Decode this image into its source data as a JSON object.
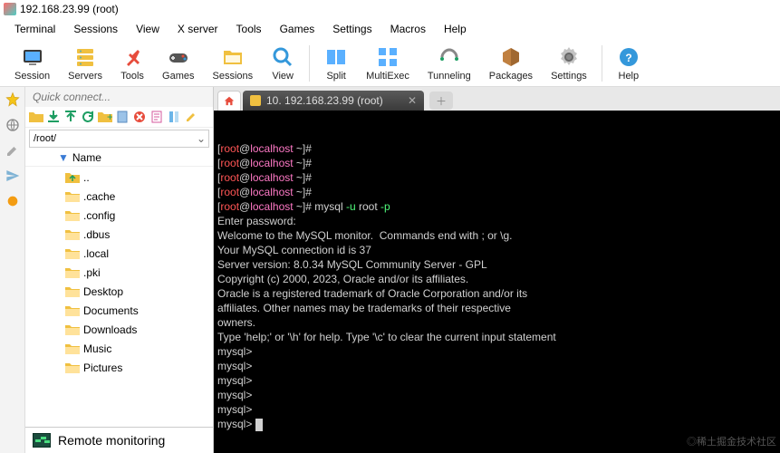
{
  "window": {
    "title": "192.168.23.99 (root)"
  },
  "menubar": [
    "Terminal",
    "Sessions",
    "View",
    "X server",
    "Tools",
    "Games",
    "Settings",
    "Macros",
    "Help"
  ],
  "toolbar": [
    {
      "label": "Session",
      "icon": "session"
    },
    {
      "label": "Servers",
      "icon": "servers"
    },
    {
      "label": "Tools",
      "icon": "tools"
    },
    {
      "label": "Games",
      "icon": "games"
    },
    {
      "label": "Sessions",
      "icon": "sessions"
    },
    {
      "label": "View",
      "icon": "view"
    },
    {
      "sep": true
    },
    {
      "label": "Split",
      "icon": "split"
    },
    {
      "label": "MultiExec",
      "icon": "multiexec"
    },
    {
      "label": "Tunneling",
      "icon": "tunneling"
    },
    {
      "label": "Packages",
      "icon": "packages"
    },
    {
      "label": "Settings",
      "icon": "settings"
    },
    {
      "sep": true
    },
    {
      "label": "Help",
      "icon": "help"
    }
  ],
  "quickconnect": {
    "placeholder": "Quick connect..."
  },
  "path": "/root/",
  "colheader": "Name",
  "tree": [
    {
      "name": "..",
      "up": true
    },
    {
      "name": ".cache"
    },
    {
      "name": ".config"
    },
    {
      "name": ".dbus"
    },
    {
      "name": ".local"
    },
    {
      "name": ".pki"
    },
    {
      "name": "Desktop"
    },
    {
      "name": "Documents"
    },
    {
      "name": "Downloads"
    },
    {
      "name": "Music"
    },
    {
      "name": "Pictures"
    }
  ],
  "remote_monitoring": "Remote monitoring",
  "tab": {
    "label": "10. 192.168.23.99 (root)"
  },
  "terminal": {
    "prompts": [
      {
        "cmd": ""
      },
      {
        "cmd": ""
      },
      {
        "cmd": ""
      },
      {
        "cmd": ""
      },
      {
        "cmd": "mysql -u root -p"
      }
    ],
    "body": [
      "Enter password:",
      "Welcome to the MySQL monitor.  Commands end with ; or \\g.",
      "Your MySQL connection id is 37",
      "Server version: 8.0.34 MySQL Community Server - GPL",
      "",
      "Copyright (c) 2000, 2023, Oracle and/or its affiliates.",
      "",
      "Oracle is a registered trademark of Oracle Corporation and/or its",
      "affiliates. Other names may be trademarks of their respective",
      "owners.",
      "",
      "Type 'help;' or '\\h' for help. Type '\\c' to clear the current input statement",
      "",
      "mysql>",
      "mysql>",
      "mysql>",
      "mysql>",
      "mysql>",
      "mysql>"
    ]
  },
  "watermark": "◎稀土掘金技术社区"
}
